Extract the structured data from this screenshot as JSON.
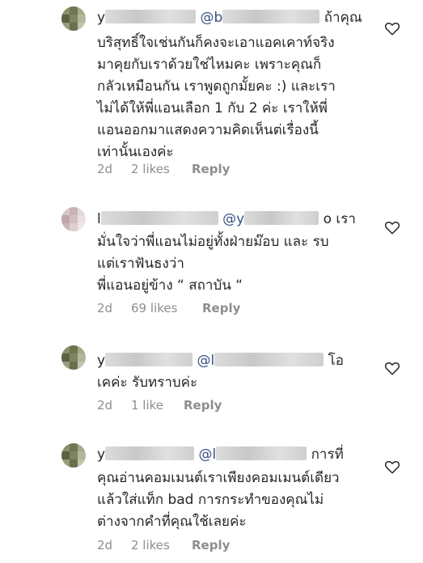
{
  "comments": [
    {
      "user_prefix": "y",
      "mention_prefix": "@b",
      "lines_first_tail": "ถ้าคุณ",
      "lines": [
        "บริสุทธิ์ใจเช่นกันก็คงจะเอาแอคเคาท์จริง",
        "มาคุยกับเราด้วยใช่ไหมคะ เพราะคุณก็",
        "กลัวเหมือนกัน เราพูดถูกมั้ยคะ :) และเรา",
        "ไม่ได้ให้พี่แอนเลือก 1 กับ 2 ค่ะ เราให้พี่",
        "แอนออกมาแสดงความคิดเห็นต่เรื่องนี้",
        "เท่านั้นเองค่ะ"
      ],
      "time": "2d",
      "likes": "2 likes",
      "reply": "Reply",
      "avatar_colors": [
        "#8a8f6a",
        "#6e7550",
        "#a7a98a",
        "#5b6143",
        "#7e8460",
        "#b4b59c",
        "#9a9c7c",
        "#6a6f4d",
        "#c2c3ad"
      ]
    },
    {
      "user_prefix": "l",
      "mention_prefix": "@y",
      "lines_first_tail": "o เรา",
      "lines": [
        "มั่นใจว่าพี่แอนไม่อยู่ทั้งฝ่ายม๊อบ และ รบ",
        "แต่เราฟันธงว่า",
        "พี่แอนอยู่ข้าง “ สถาบัน “"
      ],
      "time": "2d",
      "likes": "69 likes",
      "reply": "Reply",
      "avatar_colors": [
        "#d7c9c9",
        "#c8b3b3",
        "#e3d8d8",
        "#bfa6a8",
        "#d2c0c1",
        "#e9e1e1",
        "#c9b5b6",
        "#dccfcf",
        "#efe8e8"
      ]
    },
    {
      "user_prefix": "y",
      "mention_prefix": "@l",
      "lines_first_tail": "โอ",
      "lines": [
        "เคค่ะ รับทราบค่ะ"
      ],
      "time": "2d",
      "likes": "1 like",
      "reply": "Reply",
      "avatar_colors": [
        "#8a8f6a",
        "#6e7550",
        "#a7a98a",
        "#5b6143",
        "#7e8460",
        "#b4b59c",
        "#9a9c7c",
        "#6a6f4d",
        "#c2c3ad"
      ]
    },
    {
      "user_prefix": "y",
      "mention_prefix": "@l",
      "lines_first_tail": "การที่",
      "lines": [
        "คุณอ่านคอมเมนต์เราเพียงคอมเมนต์เดียว",
        "แล้วใส่แท็ก bad การกระทำของคุณไม่",
        "ต่างจากคำที่คุณใช้เลยค่ะ"
      ],
      "time": "2d",
      "likes": "2 likes",
      "reply": "Reply",
      "avatar_colors": [
        "#8a8f6a",
        "#6e7550",
        "#a7a98a",
        "#5b6143",
        "#7e8460",
        "#b4b59c",
        "#9a9c7c",
        "#6a6f4d",
        "#c2c3ad"
      ]
    }
  ],
  "icons": {
    "like": "heart-outline-icon"
  },
  "colors": {
    "text": "#262626",
    "mention": "#385185",
    "meta": "#8e8e8e"
  }
}
